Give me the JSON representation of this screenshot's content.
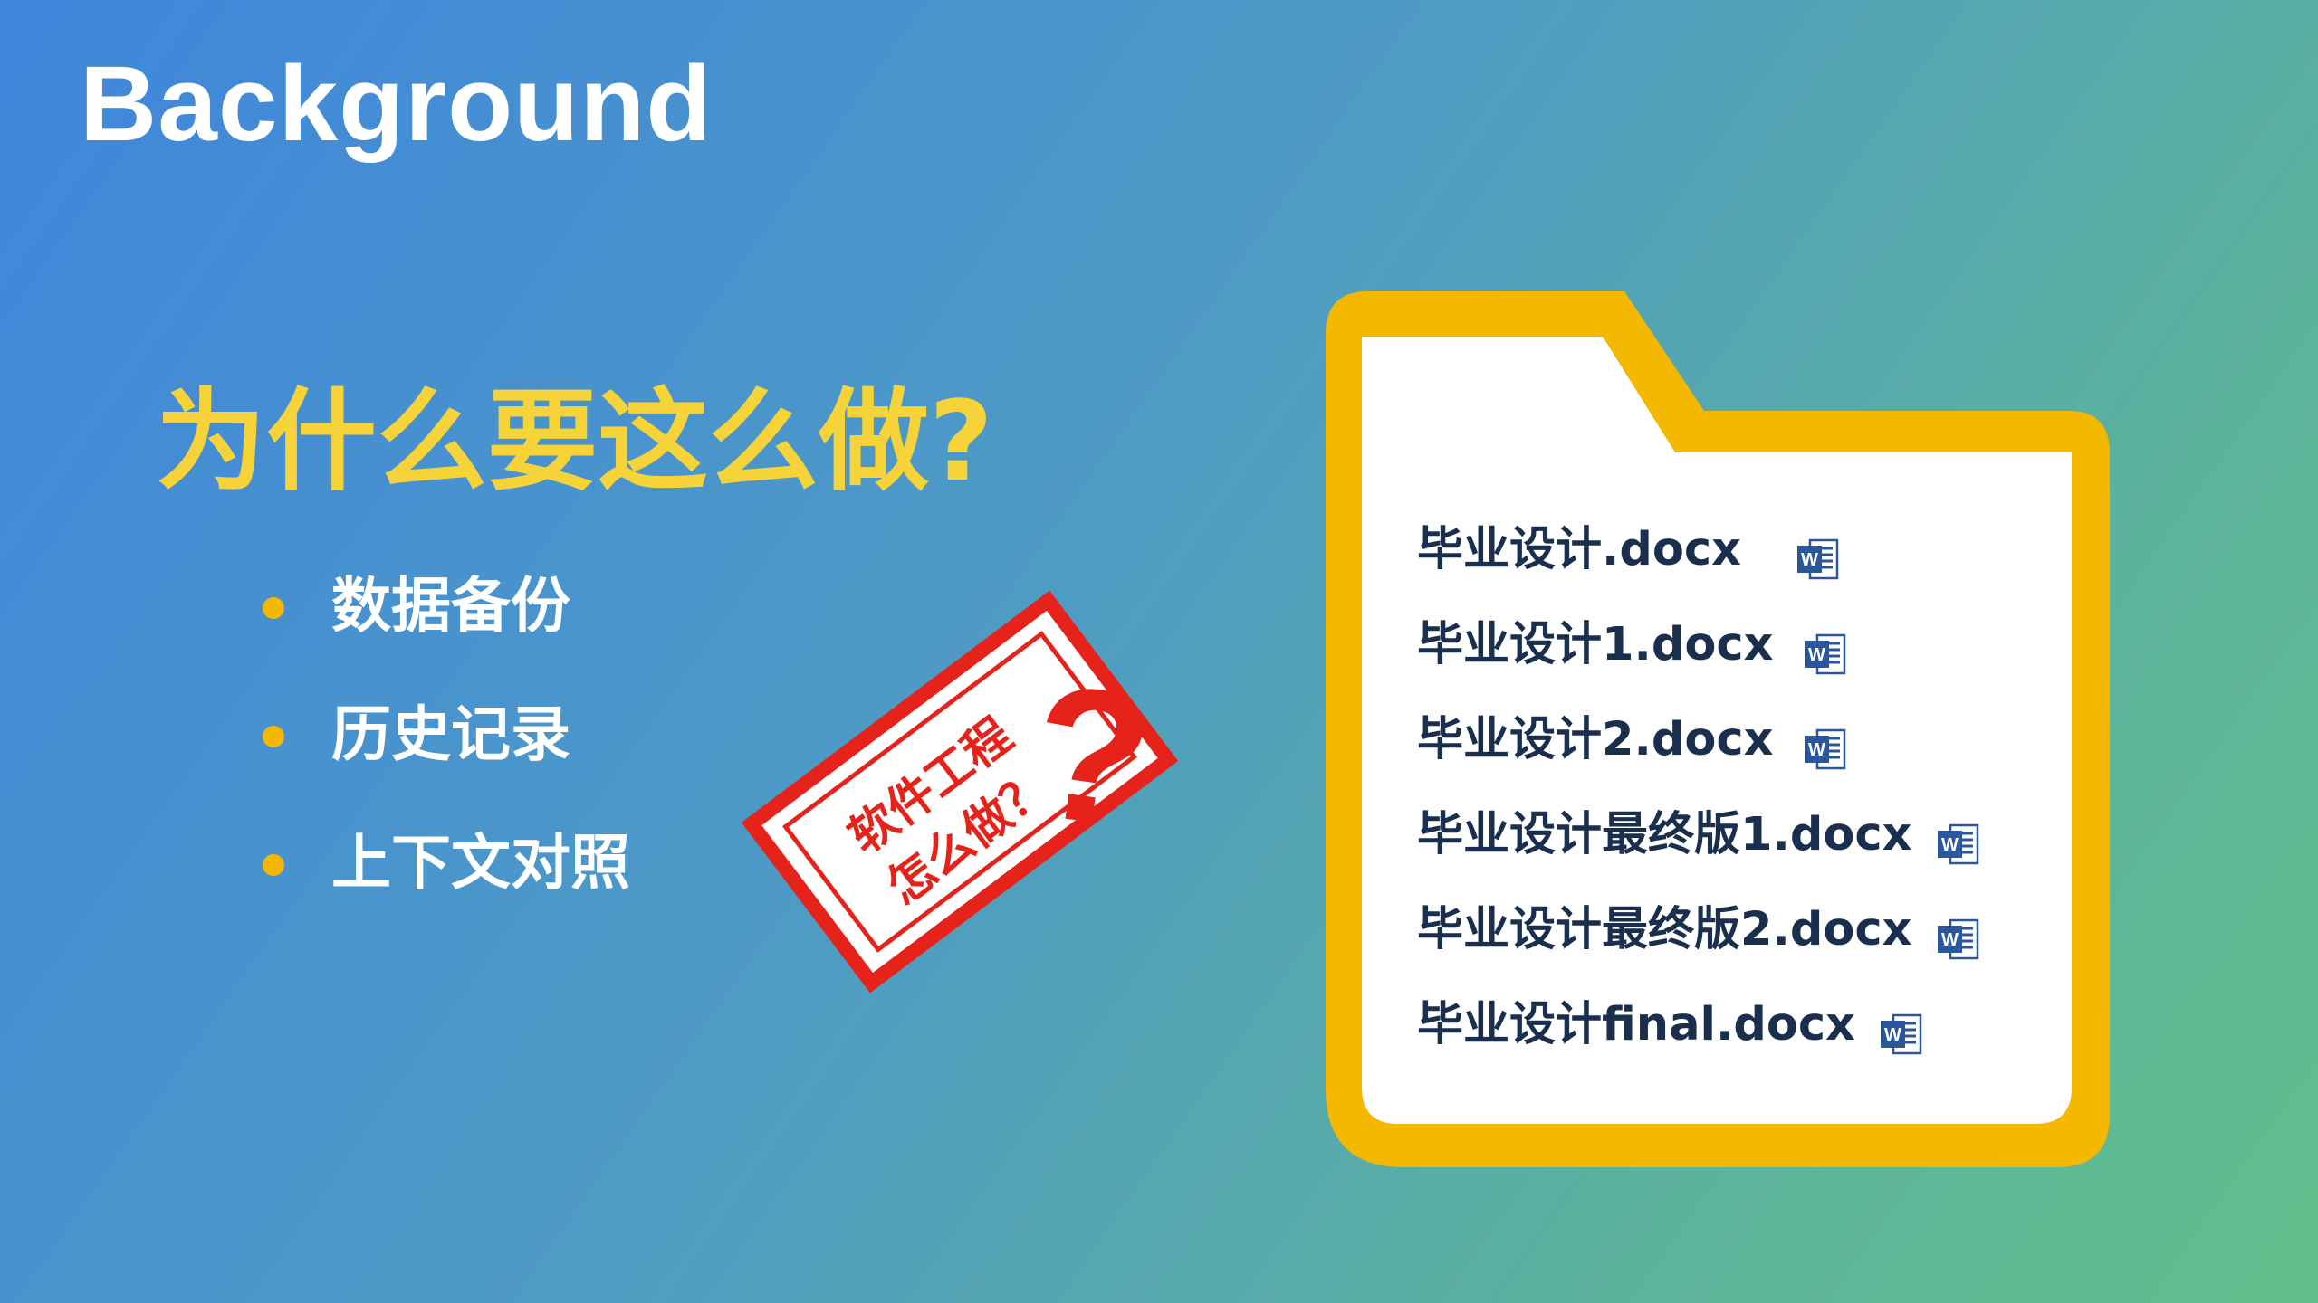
{
  "slide": {
    "title": "Background"
  },
  "main": {
    "question": "为什么要这么做?",
    "bullets": [
      "数据备份",
      "历史记录",
      "上下文对照"
    ]
  },
  "stamp": {
    "line1": "软件工程",
    "line2": "怎么做？",
    "mark": "?",
    "color": "#e5231b"
  },
  "folder": {
    "files": [
      {
        "name": "毕业设计.docx",
        "gap": 60
      },
      {
        "name": "毕业设计1.docx",
        "gap": 32
      },
      {
        "name": "毕业设计2.docx",
        "gap": 32
      },
      {
        "name": "毕业设计最终版1.docx",
        "gap": 26
      },
      {
        "name": "毕业设计最终版2.docx",
        "gap": 26
      },
      {
        "name": "毕业设计final.docx",
        "gap": 26
      }
    ],
    "icon": "word-doc-icon",
    "frame_color": "#f5b800"
  },
  "colors": {
    "accent_yellow": "#f7d33a",
    "bullet_dot": "#f5b800",
    "file_text": "#1a2f4d",
    "word_blue": "#2b579a"
  }
}
